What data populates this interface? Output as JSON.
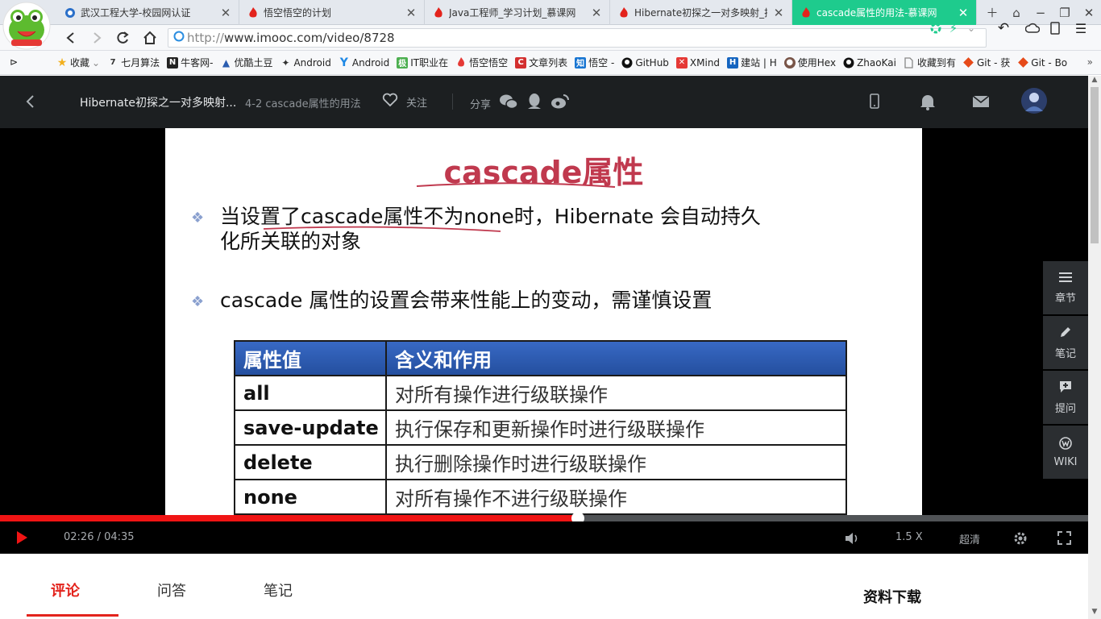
{
  "browser": {
    "tabs": [
      {
        "title": "武汉工程大学-校园网认证",
        "icon": "globe-icon",
        "active": false
      },
      {
        "title": "悟空悟空的计划",
        "icon": "flame-icon",
        "active": false
      },
      {
        "title": "Java工程师_学习计划_慕课网",
        "icon": "flame-icon",
        "active": false
      },
      {
        "title": "Hibernate初探之一对多映射_技术",
        "icon": "flame-icon",
        "active": false
      },
      {
        "title": "cascade属性的用法-慕课网",
        "icon": "flame-icon",
        "active": true
      }
    ],
    "url_protocol": "http://",
    "url_rest": "www.imooc.com/video/8728",
    "bookmarks": [
      {
        "label": "收藏",
        "icon": "star-icon",
        "color": "#f2b01e"
      },
      {
        "label": "七月算法",
        "icon": "seven-icon",
        "color": "#333333"
      },
      {
        "label": "牛客网-",
        "icon": "nowcoder-icon",
        "color": "#222222"
      },
      {
        "label": "优酷土豆",
        "icon": "youku-icon",
        "color": "#2a5db0"
      },
      {
        "label": "Android",
        "icon": "android-icon",
        "color": "#333333"
      },
      {
        "label": "Android",
        "icon": "ydoc-icon",
        "color": "#1e88e5"
      },
      {
        "label": "IT职业在",
        "icon": "jiker-icon",
        "color": "#4caf50"
      },
      {
        "label": "悟空悟空",
        "icon": "flame-icon",
        "color": "#e53935"
      },
      {
        "label": "文章列表",
        "icon": "csdn-icon",
        "color": "#d32f2f"
      },
      {
        "label": "悟空 -",
        "icon": "zhihu-icon",
        "color": "#1976d2"
      },
      {
        "label": "GitHub",
        "icon": "github-icon",
        "color": "#111111"
      },
      {
        "label": "XMind",
        "icon": "xmind-icon",
        "color": "#e53935"
      },
      {
        "label": "建站 | H",
        "icon": "hexo-icon",
        "color": "#1565c0"
      },
      {
        "label": "使用Hex",
        "icon": "user-icon",
        "color": "#795548"
      },
      {
        "label": "ZhaoKai",
        "icon": "github-icon",
        "color": "#111111"
      },
      {
        "label": "收藏到有",
        "icon": "doc-icon",
        "color": "#888888"
      },
      {
        "label": "Git - 获",
        "icon": "git-icon",
        "color": "#e64a19"
      },
      {
        "label": "Git - Bo",
        "icon": "git-icon",
        "color": "#e64a19"
      }
    ]
  },
  "header": {
    "course_title": "Hibernate初探之一对多映射...",
    "lesson_title": "4-2 cascade属性的用法",
    "follow_label": "关注",
    "share_label": "分享"
  },
  "slide": {
    "title": "cascade属性",
    "bullet1_line1": "当设置了cascade属性不为none时，Hibernate 会自动持久",
    "bullet1_line2": "化所关联的对象",
    "bullet2": "cascade 属性的设置会带来性能上的变动，需谨慎设置",
    "table_headers": [
      "属性值",
      "含义和作用"
    ],
    "table_rows": [
      [
        "all",
        "对所有操作进行级联操作"
      ],
      [
        "save-update",
        "执行保存和更新操作时进行级联操作"
      ],
      [
        "delete",
        "执行删除操作时进行级联操作"
      ],
      [
        "none",
        "对所有操作不进行级联操作"
      ]
    ]
  },
  "side_panel": [
    {
      "label": "章节",
      "icon": "list-icon"
    },
    {
      "label": "笔记",
      "icon": "pencil-icon"
    },
    {
      "label": "提问",
      "icon": "question-icon"
    },
    {
      "label": "WIKI",
      "icon": "wiki-icon"
    }
  ],
  "player": {
    "time_display": "02:26 / 04:35",
    "progress": 0.5309,
    "speed": "1.5 X",
    "quality": "超清"
  },
  "below": {
    "tabs": [
      "评论",
      "问答",
      "笔记"
    ],
    "downloads_title": "资料下载"
  },
  "colors": {
    "accent_red": "#e3231c",
    "active_tab": "#1ecb8d",
    "slide_title": "#c0394e"
  }
}
